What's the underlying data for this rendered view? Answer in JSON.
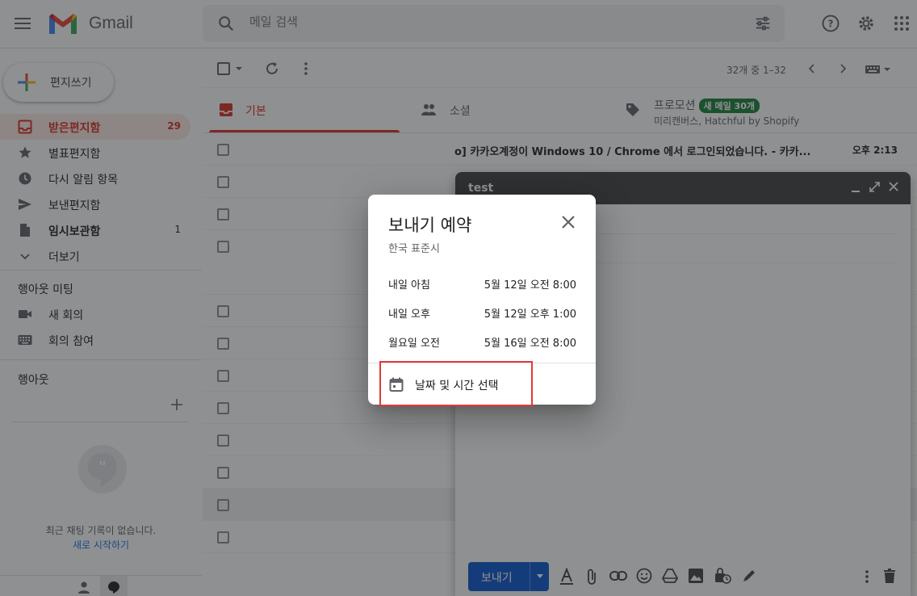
{
  "app": {
    "name": "Gmail"
  },
  "search": {
    "placeholder": "메일 검색"
  },
  "compose_button": {
    "label": "편지쓰기"
  },
  "nav": [
    {
      "label": "받은편지함",
      "count": "29",
      "icon": "inbox-icon"
    },
    {
      "label": "별표편지함",
      "count": "",
      "icon": "star-icon"
    },
    {
      "label": "다시 알림 항목",
      "count": "",
      "icon": "clock-icon"
    },
    {
      "label": "보낸편지함",
      "count": "",
      "icon": "send-icon"
    },
    {
      "label": "임시보관함",
      "count": "1",
      "icon": "draft-icon"
    },
    {
      "label": "더보기",
      "count": "",
      "icon": "chevron-down-icon"
    }
  ],
  "meet": {
    "title": "행아웃 미팅",
    "new_meeting": "새 회의",
    "join": "회의 참여"
  },
  "hangouts": {
    "title": "행아웃",
    "empty_text": "최근 채팅 기록이 없습니다.",
    "start_link": "새로 시작하기"
  },
  "toolbar": {
    "pager": "32개 중 1–32"
  },
  "tabs": [
    {
      "label": "기본"
    },
    {
      "label": "소셜"
    },
    {
      "label": "프로모션",
      "badge": "새 메일 30개",
      "sub": "미리캔버스, Hatchful by Shopify"
    }
  ],
  "rows": [
    {
      "text": "o] 카카오계정이 Windows 10 / Chrome 에서 로그인되었습니다. - 카카...",
      "time": "오후 2:13"
    }
  ],
  "compose_window": {
    "title": "test",
    "send_label": "보내기"
  },
  "schedule_dialog": {
    "title": "보내기 예약",
    "timezone": "한국 표준시",
    "options": [
      {
        "label": "내일 아침",
        "value": "5월 12일 오전 8:00"
      },
      {
        "label": "내일 오후",
        "value": "5월 12일 오후 1:00"
      },
      {
        "label": "월요일 오전",
        "value": "5월 16일 오전 8:00"
      }
    ],
    "pick_label": "날짜 및 시간 선택"
  },
  "colors": {
    "accent": "#d93025",
    "send": "#0b57d0",
    "badge": "#188038",
    "highlight": "#e53935"
  }
}
